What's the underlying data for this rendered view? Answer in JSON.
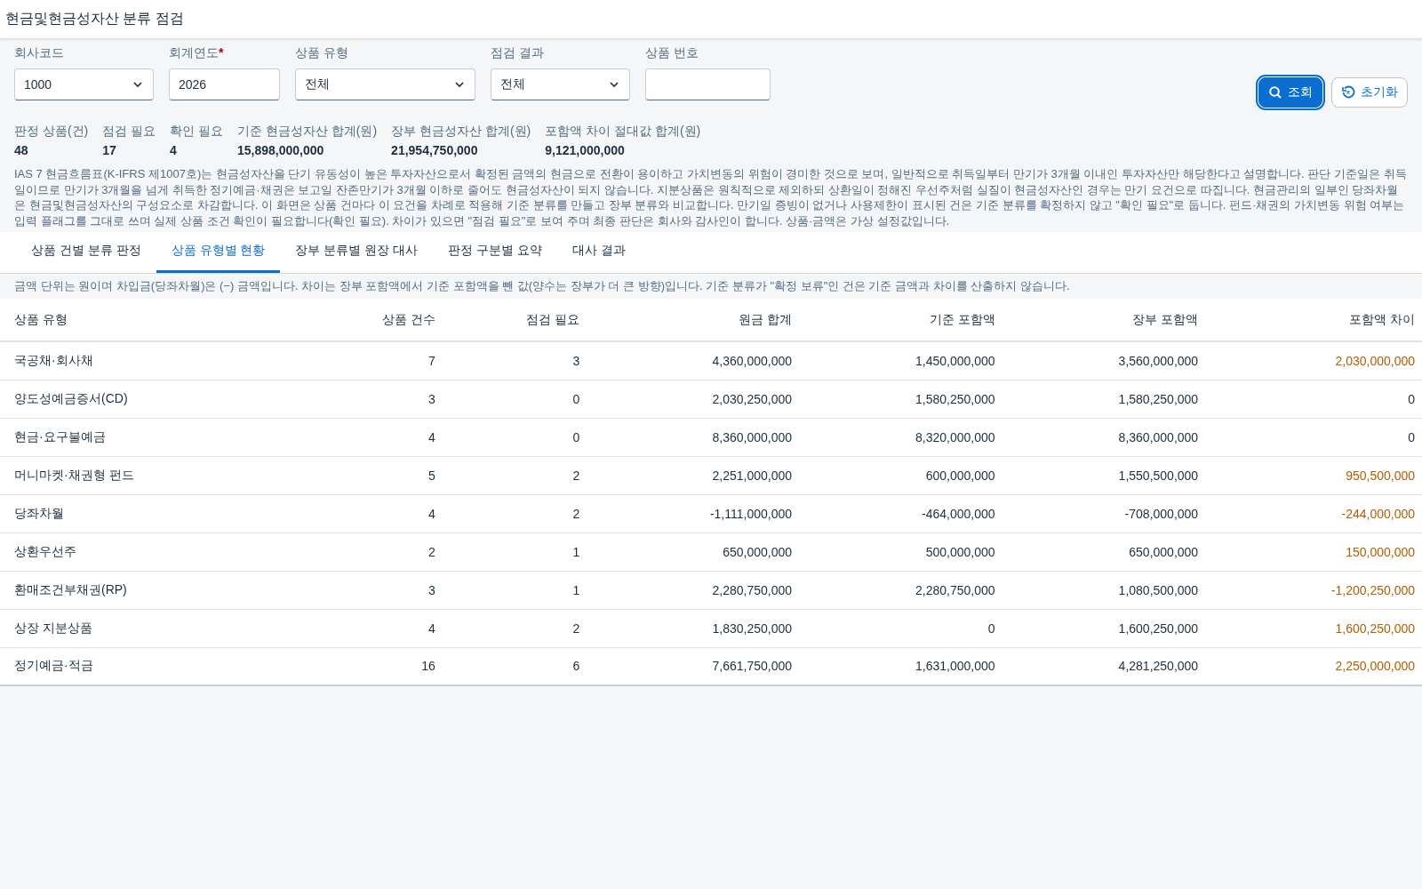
{
  "window": {
    "title": "현금및현금성자산 분류 점검"
  },
  "filters": [
    {
      "kind": "select",
      "label": "회사코드",
      "value": "1000"
    },
    {
      "kind": "text",
      "label": "회계연도",
      "value": "2026",
      "required_mark": "*"
    },
    {
      "kind": "select",
      "label": "상품 유형",
      "value": "전체"
    },
    {
      "kind": "select",
      "label": "점검 결과",
      "value": "전체"
    },
    {
      "kind": "text",
      "label": "상품 번호"
    }
  ],
  "buttons": [
    {
      "kind": "primary",
      "label": "조회"
    },
    {
      "kind": "secondary",
      "label": "초기화"
    }
  ],
  "summary": [
    {
      "label": "판정 상품(건)",
      "value": "48"
    },
    {
      "label": "점검 필요",
      "value": "17"
    },
    {
      "label": "확인 필요",
      "value": "4"
    },
    {
      "label": "기준 현금성자산 합계(원)",
      "value": "15,898,000,000"
    },
    {
      "label": "장부 현금성자산 합계(원)",
      "value": "21,954,750,000"
    },
    {
      "label": "포함액 차이 절대값 합계(원)",
      "value": "9,121,000,000"
    }
  ],
  "description": "IAS 7 현금흐름표(K-IFRS 제1007호)는 현금성자산을 단기 유동성이 높은 투자자산으로서 확정된 금액의 현금으로 전환이 용이하고 가치변동의 위험이 경미한 것으로 보며, 일반적으로 취득일부터 만기가 3개월 이내인 투자자산만 해당한다고 설명합니다. 판단 기준일은 취득일이므로 만기가 3개월을 넘게 취득한 정기예금·채권은 보고일 잔존만기가 3개월 이하로 줄어도 현금성자산이 되지 않습니다. 지분상품은 원칙적으로 제외하되 상환일이 정해진 우선주처럼 실질이 현금성자산인 경우는 만기 요건으로 따집니다. 현금관리의 일부인 당좌차월은 현금및현금성자산의 구성요소로 차감합니다. 이 화면은 상품 건마다 이 요건을 차례로 적용해 기준 분류를 만들고 장부 분류와 비교합니다. 만기일 증빙이 없거나 사용제한이 표시된 건은 기준 분류를 확정하지 않고 \"확인 필요\"로 둡니다. 펀드·채권의 가치변동 위험 여부는 입력 플래그를 그대로 쓰며 실제 상품 조건 확인이 필요합니다(확인 필요). 차이가 있으면 \"점검 필요\"로 보여 주며 최종 판단은 회사와 감사인이 합니다. 상품·금액은 가상 설정값입니다.",
  "tabs": [
    {
      "label": "상품 건별 분류 판정",
      "selected": false
    },
    {
      "label": "상품 유형별 현황",
      "selected": true
    },
    {
      "label": "장부 분류별 원장 대사",
      "selected": false
    },
    {
      "label": "판정 구분별 요약",
      "selected": false
    },
    {
      "label": "대사 결과",
      "selected": false
    }
  ],
  "note": "금액 단위는 원이며 차입금(당좌차월)은 (−) 금액입니다. 차이는 장부 포함액에서 기준 포함액을 뺀 값(양수는 장부가 더 큰 방향)입니다. 기준 분류가 \"확정 보류\"인 건은 기준 금액과 차이를 산출하지 않습니다.",
  "table": {
    "columns": [
      "상품 유형",
      "상품 건수",
      "점검 필요",
      "원금 합계",
      "기준 포함액",
      "장부 포함액",
      "포함액 차이"
    ],
    "rows": [
      {
        "cells": [
          "국공채·회사채",
          "7",
          "3",
          "4,360,000,000",
          "1,450,000,000",
          "3,560,000,000",
          "2,030,000,000"
        ],
        "color": "#b35c00"
      },
      {
        "cells": [
          "양도성예금증서(CD)",
          "3",
          "0",
          "2,030,250,000",
          "1,580,250,000",
          "1,580,250,000",
          "0"
        ],
        "color": "#1d2d3e"
      },
      {
        "cells": [
          "현금·요구불예금",
          "4",
          "0",
          "8,360,000,000",
          "8,320,000,000",
          "8,360,000,000",
          "0"
        ],
        "color": "#1d2d3e"
      },
      {
        "cells": [
          "머니마켓·채권형 펀드",
          "5",
          "2",
          "2,251,000,000",
          "600,000,000",
          "1,550,500,000",
          "950,500,000"
        ],
        "color": "#b35c00"
      },
      {
        "cells": [
          "당좌차월",
          "4",
          "2",
          "-1,111,000,000",
          "-464,000,000",
          "-708,000,000",
          "-244,000,000"
        ],
        "color": "#b35c00"
      },
      {
        "cells": [
          "상환우선주",
          "2",
          "1",
          "650,000,000",
          "500,000,000",
          "650,000,000",
          "150,000,000"
        ],
        "color": "#b35c00"
      },
      {
        "cells": [
          "환매조건부채권(RP)",
          "3",
          "1",
          "2,280,750,000",
          "2,280,750,000",
          "1,080,500,000",
          "-1,200,250,000"
        ],
        "color": "#b35c00"
      },
      {
        "cells": [
          "상장 지분상품",
          "4",
          "2",
          "1,830,250,000",
          "0",
          "1,600,250,000",
          "1,600,250,000"
        ],
        "color": "#b35c00"
      },
      {
        "cells": [
          "정기예금·적금",
          "16",
          "6",
          "7,661,750,000",
          "1,631,000,000",
          "4,281,250,000",
          "2,250,000,000"
        ],
        "color": "#b35c00"
      }
    ]
  }
}
